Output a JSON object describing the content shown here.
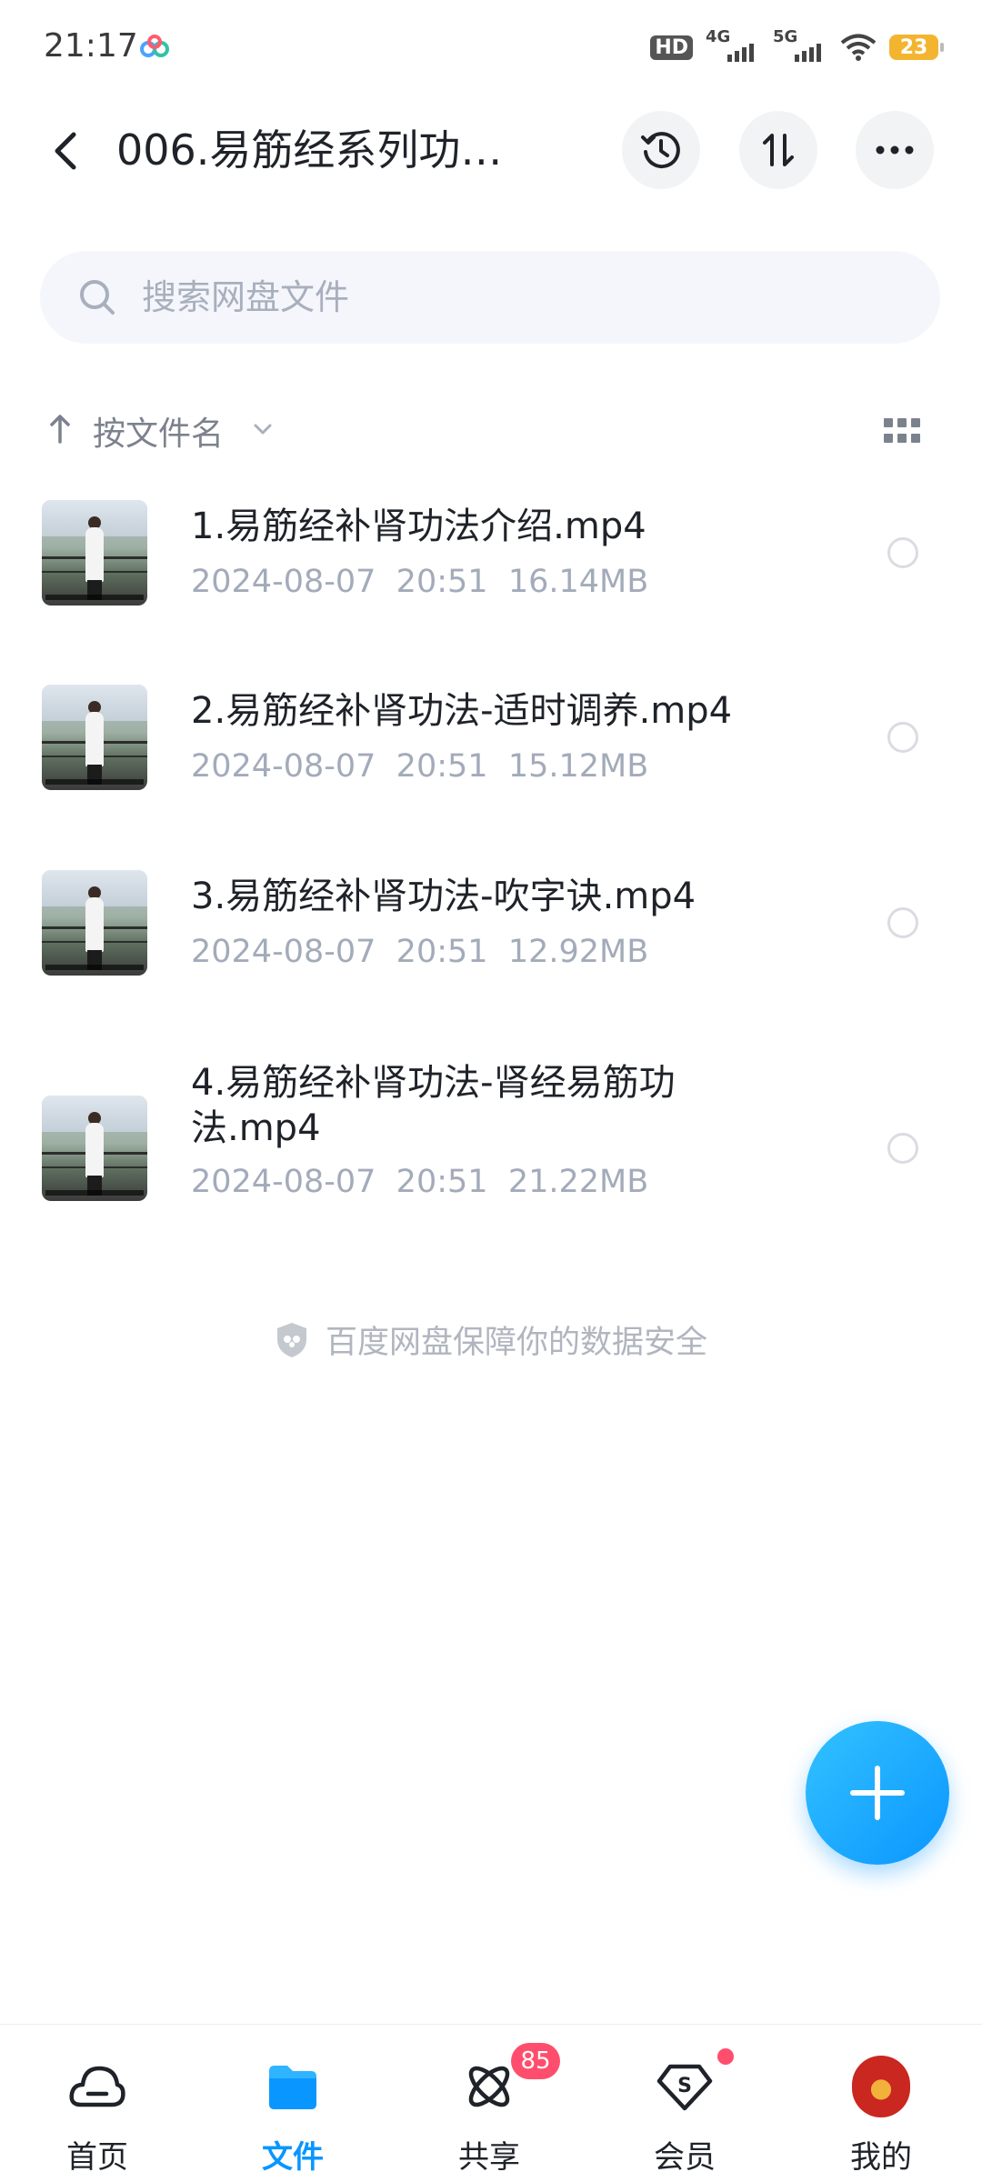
{
  "status_bar": {
    "time": "21:17",
    "hd_label": "HD",
    "net_4g": "4G",
    "net_5g": "5G",
    "battery": "23",
    "battery_color": "#f3b52f"
  },
  "header": {
    "title": "006.易筋经系列功…",
    "back_icon": "chevron-left-icon",
    "history_icon": "history-icon",
    "sort_icon": "sort-arrows-icon",
    "more_icon": "more-dots-icon"
  },
  "search": {
    "placeholder": "搜索网盘文件",
    "value": ""
  },
  "sort_bar": {
    "label": "按文件名",
    "direction": "ascending",
    "view_icon": "grid-view-icon"
  },
  "files": [
    {
      "name": "1.易筋经补肾功法介绍.mp4",
      "date": "2024-08-07",
      "time": "20:51",
      "size": "16.14MB"
    },
    {
      "name": "2.易筋经补肾功法-适时调养.mp4",
      "date": "2024-08-07",
      "time": "20:51",
      "size": "15.12MB"
    },
    {
      "name": "3.易筋经补肾功法-吹字诀.mp4",
      "date": "2024-08-07",
      "time": "20:51",
      "size": "12.92MB"
    },
    {
      "name": "4.易筋经补肾功法-肾经易筋功法.mp4",
      "date": "2024-08-07",
      "time": "20:51",
      "size": "21.22MB"
    }
  ],
  "footer_note": "百度网盘保障你的数据安全",
  "fab_icon": "plus-icon",
  "nav": {
    "items": [
      {
        "label": "首页",
        "icon": "cloud-home-icon"
      },
      {
        "label": "文件",
        "icon": "folder-icon"
      },
      {
        "label": "共享",
        "icon": "share-orbit-icon",
        "badge": "85"
      },
      {
        "label": "会员",
        "icon": "vip-diamond-icon"
      },
      {
        "label": "我的",
        "icon": "avatar"
      }
    ],
    "active": "文件"
  },
  "colors": {
    "accent": "#0a96ff",
    "badge": "#ff4e6d",
    "meta_text": "#a3abba"
  }
}
